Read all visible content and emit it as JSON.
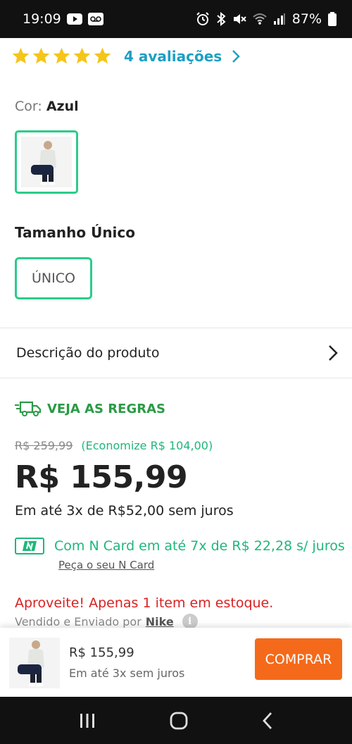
{
  "status_bar": {
    "time": "19:09",
    "battery": "87%",
    "icons": [
      "youtube-icon",
      "voicemail-icon",
      "alarm-icon",
      "bluetooth-icon",
      "mute-icon",
      "wifi-icon",
      "signal-icon",
      "battery-icon"
    ]
  },
  "rating": {
    "stars": 5,
    "label": "4 avaliações",
    "star_color": "#f5c518"
  },
  "color": {
    "prefix": "Cor:",
    "value": "Azul"
  },
  "size": {
    "title": "Tamanho Único",
    "option": "ÚNICO"
  },
  "description": {
    "label": "Descrição do produto"
  },
  "shipping": {
    "label": "VEJA AS REGRAS"
  },
  "pricing": {
    "old_price": "R$ 259,99",
    "savings": "(Economize R$ 104,00)",
    "price": "R$ 155,99",
    "installments": "Em até 3x de R$52,00 sem juros",
    "ncard_text": "Com N Card em até 7x de R$ 22,28 s/ juros",
    "ncard_link": "Peça o seu N Card"
  },
  "stock": {
    "alert": "Aproveite! Apenas 1 item em estoque.",
    "sold_by_prefix": "Vendido e Enviado por",
    "seller": "Nike"
  },
  "buy_bar": {
    "price": "R$ 155,99",
    "installments": "Em até 3x sem juros",
    "button": "COMPRAR",
    "button_color": "#f46a1a"
  },
  "colors": {
    "accent_green": "#2bcc8a",
    "link_blue": "#1d9fc4",
    "alert_red": "#d92121"
  }
}
